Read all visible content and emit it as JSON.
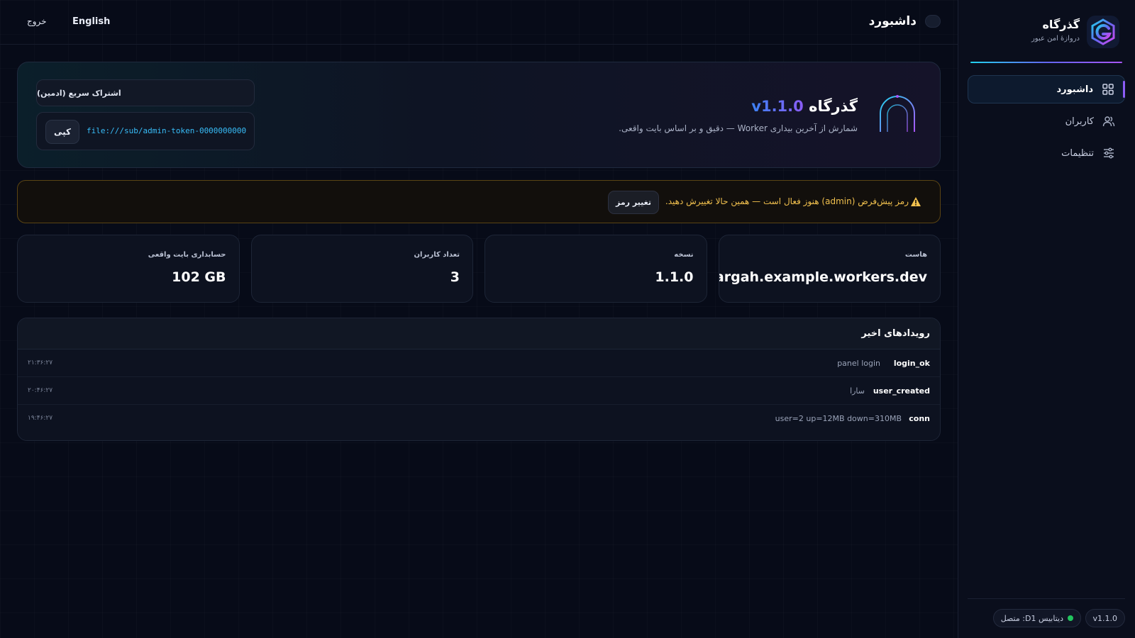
{
  "app": {
    "name": "گذرگاه",
    "tagline": "دروازهٔ امن عبور"
  },
  "sidebar": {
    "items": [
      {
        "label": "داشبورد",
        "icon": "grid-icon",
        "active": true
      },
      {
        "label": "کاربران",
        "icon": "users-icon",
        "active": false
      },
      {
        "label": "تنظیمات",
        "icon": "sliders-icon",
        "active": false
      }
    ],
    "footer": {
      "db_status": "دیتابیس D1: متصل",
      "version": "v1.1.0"
    }
  },
  "topbar": {
    "title": "داشبورد",
    "language": "English",
    "logout": "خروج"
  },
  "hero": {
    "title": "گذرگاه",
    "version": "v1.1.0",
    "subtitle": "شمارش از آخرین بیداری Worker — دقیق و بر اساس بایت واقعی.",
    "share_label": "اشتراک سریع (ادمین)",
    "share_link": "file:///sub/admin-token-0000000000",
    "copy_label": "کپی"
  },
  "alert": {
    "text": "رمز پیش‌فرض (admin) هنوز فعال است — همین حالا تغییرش دهید.",
    "button": "تغییر رمز"
  },
  "stats": [
    {
      "label": "هاست",
      "value": "gozargah.example.workers.dev"
    },
    {
      "label": "نسخه",
      "value": "1.1.0"
    },
    {
      "label": "تعداد کاربران",
      "value": "3"
    },
    {
      "label": "حسابداری بایت واقعی",
      "value": "102 GB"
    }
  ],
  "events": {
    "title": "رویدادهای اخیر",
    "rows": [
      {
        "type": "login_ok",
        "detail": "panel login",
        "time": "۲۱:۳۶:۲۷"
      },
      {
        "type": "user_created",
        "detail": "سارا",
        "time": "۲۰:۴۶:۲۷"
      },
      {
        "type": "conn",
        "detail": "user=2 up=12MB down=310MB",
        "time": "۱۹:۴۶:۲۷"
      }
    ]
  },
  "colors": {
    "accent": "#8b5cf6",
    "link": "#38bdf8",
    "warning": "#f2c14e",
    "success": "#22c55e",
    "background": "#070b18"
  }
}
